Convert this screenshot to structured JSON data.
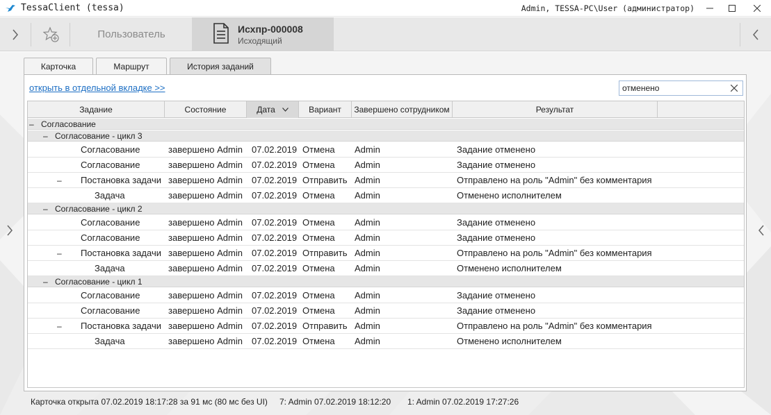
{
  "window": {
    "title": "TessaClient (tessa)",
    "user": "Admin, TESSA-PC\\User (администратор)"
  },
  "toolbar": {
    "user_tab": "Пользователь",
    "doc_title": "Исхпр-000008",
    "doc_subtitle": "Исходящий"
  },
  "tabs": [
    {
      "label": "Карточка"
    },
    {
      "label": "Маршрут"
    },
    {
      "label": "История заданий"
    }
  ],
  "panel": {
    "open_link": "открыть в отдельной вкладке >>",
    "search_value": "отменено"
  },
  "grid": {
    "columns": [
      "Задание",
      "Состояние",
      "Дата",
      "Вариант",
      "Завершено сотрудником",
      "Результат"
    ],
    "sorted_column": "Дата",
    "root_group": "Согласование",
    "cycles": [
      {
        "label": "Согласование - цикл 3",
        "rows": [
          {
            "task": "Согласование",
            "state": "завершено Admin",
            "date": "07.02.2019",
            "option": "Отмена",
            "by": "Admin",
            "result": "Задание отменено"
          },
          {
            "task": "Согласование",
            "state": "завершено Admin",
            "date": "07.02.2019",
            "option": "Отмена",
            "by": "Admin",
            "result": "Задание отменено"
          },
          {
            "task": "Постановка задачи",
            "state": "завершено Admin",
            "date": "07.02.2019",
            "option": "Отправить",
            "by": "Admin",
            "result": "Отправлено на роль \"Admin\" без комментария",
            "toggle": "–"
          },
          {
            "task": "Задача",
            "state": "завершено Admin",
            "date": "07.02.2019",
            "option": "Отмена",
            "by": "Admin",
            "result": "Отменено исполнителем",
            "child": true
          }
        ]
      },
      {
        "label": "Согласование - цикл 2",
        "rows": [
          {
            "task": "Согласование",
            "state": "завершено Admin",
            "date": "07.02.2019",
            "option": "Отмена",
            "by": "Admin",
            "result": "Задание отменено"
          },
          {
            "task": "Согласование",
            "state": "завершено Admin",
            "date": "07.02.2019",
            "option": "Отмена",
            "by": "Admin",
            "result": "Задание отменено"
          },
          {
            "task": "Постановка задачи",
            "state": "завершено Admin",
            "date": "07.02.2019",
            "option": "Отправить",
            "by": "Admin",
            "result": "Отправлено на роль \"Admin\" без комментария",
            "toggle": "–"
          },
          {
            "task": "Задача",
            "state": "завершено Admin",
            "date": "07.02.2019",
            "option": "Отмена",
            "by": "Admin",
            "result": "Отменено исполнителем",
            "child": true
          }
        ]
      },
      {
        "label": "Согласование - цикл 1",
        "rows": [
          {
            "task": "Согласование",
            "state": "завершено Admin",
            "date": "07.02.2019",
            "option": "Отмена",
            "by": "Admin",
            "result": "Задание отменено"
          },
          {
            "task": "Согласование",
            "state": "завершено Admin",
            "date": "07.02.2019",
            "option": "Отмена",
            "by": "Admin",
            "result": "Задание отменено"
          },
          {
            "task": "Постановка задачи",
            "state": "завершено Admin",
            "date": "07.02.2019",
            "option": "Отправить",
            "by": "Admin",
            "result": "Отправлено на роль \"Admin\" без комментария",
            "toggle": "–"
          },
          {
            "task": "Задача",
            "state": "завершено Admin",
            "date": "07.02.2019",
            "option": "Отмена",
            "by": "Admin",
            "result": "Отменено исполнителем",
            "child": true
          }
        ]
      }
    ]
  },
  "statusbar": {
    "opened": "Карточка открыта 07.02.2019 18:17:28 за 91 мс (80 мс без UI)",
    "version": "7:  Admin  07.02.2019 18:12:20",
    "created": "1:  Admin  07.02.2019 17:27:26"
  },
  "icons": {
    "app": "tessa-bird-icon",
    "minimize": "minimize-icon",
    "maximize": "maximize-icon",
    "close": "close-icon",
    "favorite": "star-add-icon",
    "document": "document-icon",
    "clear": "clear-icon",
    "sort": "chevron-down-icon"
  },
  "colors": {
    "accent": "#1d6fc4",
    "toolbar_bg": "#e8e8e8",
    "active_tab_bg": "#d5d5d5",
    "group_row_bg": "#e6e6e6"
  }
}
